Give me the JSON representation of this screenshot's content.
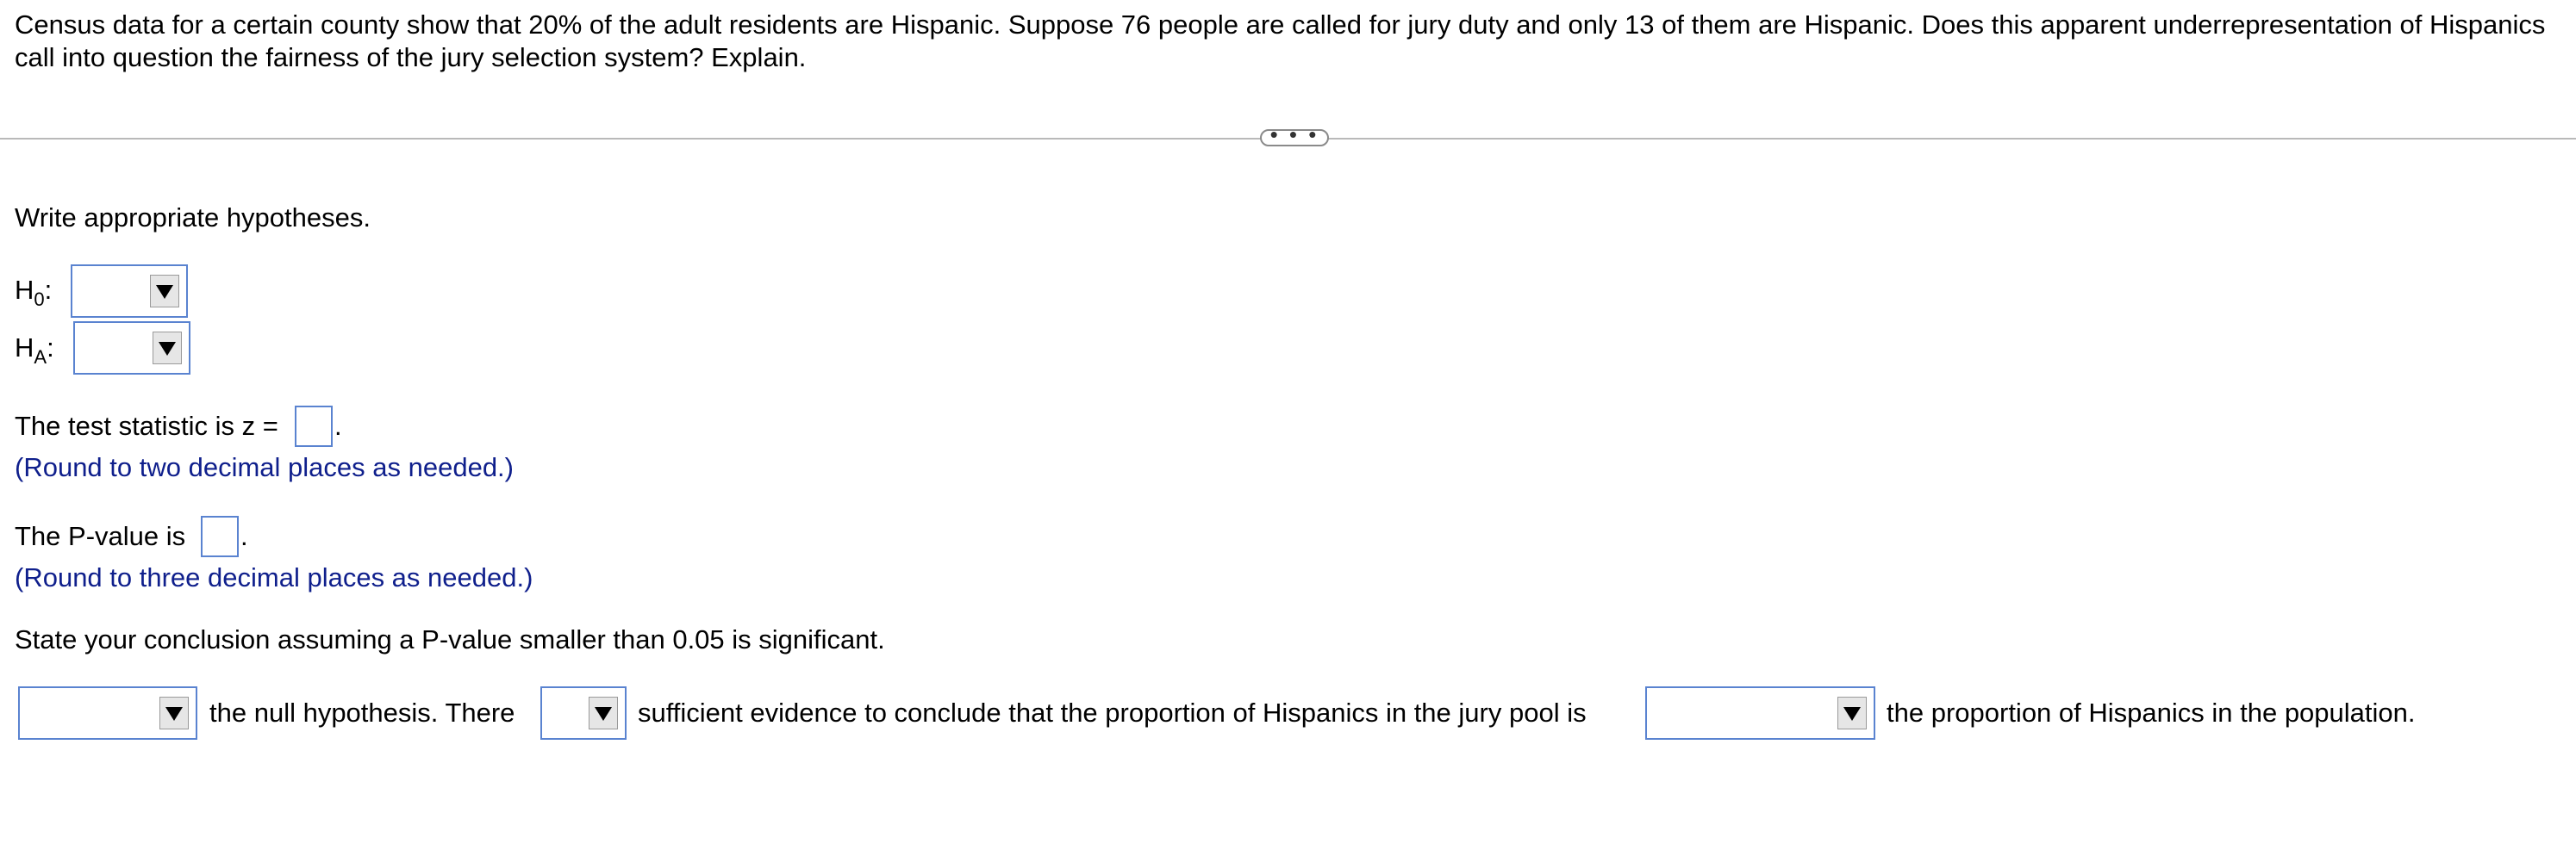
{
  "question": {
    "text": "Census data for a certain county show that 20% of the adult residents are Hispanic. Suppose 76 people are called for jury duty and only 13 of them are Hispanic. Does this apparent underrepresentation of Hispanics call into question the fairness of the jury selection system? Explain."
  },
  "expand_button": {
    "label": "• • •"
  },
  "hypotheses": {
    "prompt": "Write appropriate hypotheses.",
    "h0_letter": "H",
    "h0_sub": "0",
    "ha_letter": "H",
    "ha_sub": "A",
    "colon": ":"
  },
  "test_statistic": {
    "label": "The test statistic is z =",
    "period": ".",
    "hint": "(Round to two decimal places as needed.)",
    "value": ""
  },
  "p_value": {
    "label": "The P-value is",
    "period": ".",
    "hint": "(Round to three decimal places as needed.)",
    "value": ""
  },
  "conclusion": {
    "prompt": "State your conclusion assuming a P-value smaller than 0.05 is significant.",
    "text1": "the null hypothesis. There",
    "text2": "sufficient evidence to conclude that the proportion of Hispanics in the jury pool is",
    "text3": "the proportion of Hispanics in the population."
  },
  "colors": {
    "input_border": "#5a83d0",
    "hint_text": "#0f1f8c",
    "divider": "#b9b9b9"
  }
}
